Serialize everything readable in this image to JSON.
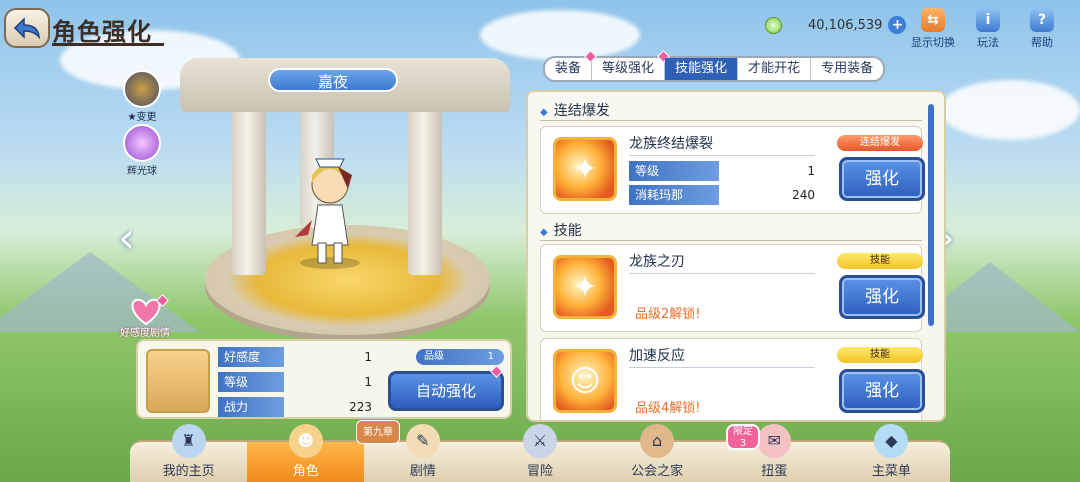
{
  "header": {
    "title": "角色强化",
    "money": "40,106,539"
  },
  "top_icons": [
    {
      "label": "显示切换",
      "icon": "person-swap-icon"
    },
    {
      "label": "玩法",
      "icon": "info-icon"
    },
    {
      "label": "帮助",
      "icon": "help-icon"
    }
  ],
  "side": {
    "change_label": "★变更",
    "orb_label": "辉光球",
    "love_story_label": "好感度剧情"
  },
  "character": {
    "name": "嘉夜"
  },
  "tabs": [
    {
      "label": "装备",
      "active": false,
      "badge": true
    },
    {
      "label": "等级强化",
      "active": false,
      "badge": true
    },
    {
      "label": "技能强化",
      "active": true,
      "badge": false
    },
    {
      "label": "才能开花",
      "active": false,
      "badge": false
    },
    {
      "label": "专用装备",
      "active": false,
      "badge": false
    }
  ],
  "skills": {
    "section1_title": "连结爆发",
    "section2_title": "技能",
    "ub": {
      "name": "龙族终结爆裂",
      "badge": "连结爆发",
      "level_label": "等级",
      "level": "1",
      "cost_label": "消耗玛那",
      "cost": "240",
      "button": "强化"
    },
    "skill1": {
      "name": "龙族之刃",
      "badge": "技能",
      "lock": "品级2解锁!",
      "button": "强化"
    },
    "skill2": {
      "name": "加速反应",
      "badge": "技能",
      "lock": "品级4解锁!",
      "button": "强化"
    }
  },
  "info": {
    "affection_label": "好感度",
    "affection": "1",
    "level_label": "等级",
    "level": "1",
    "power_label": "战力",
    "power": "223",
    "grade_label": "品级",
    "grade": "1",
    "auto_button": "自动强化"
  },
  "nav": [
    {
      "label": "我的主页",
      "icon": "castle-icon"
    },
    {
      "label": "角色",
      "icon": "character-icon"
    },
    {
      "label": "剧情",
      "icon": "scroll-icon"
    },
    {
      "label": "冒险",
      "icon": "sword-icon"
    },
    {
      "label": "公会之家",
      "icon": "house-icon"
    },
    {
      "label": "扭蛋",
      "icon": "gacha-icon"
    },
    {
      "label": "主菜单",
      "icon": "crystal-icon"
    }
  ],
  "nav_extra": {
    "limited_badge": "限定",
    "limited_count": "3",
    "story_badge": "第九章"
  },
  "colors": {
    "accent_blue": "#2e60b8",
    "badge_red": "#e8572b",
    "badge_yellow": "#f2c52a",
    "active_nav": "#f08a1c"
  }
}
